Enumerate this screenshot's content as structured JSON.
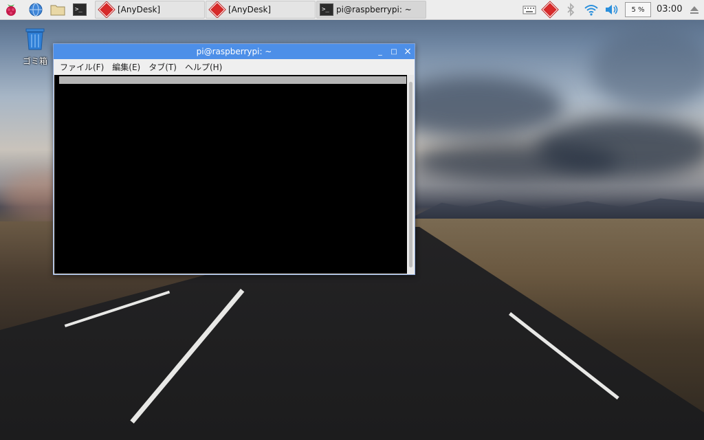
{
  "taskbar": {
    "tasks": [
      {
        "label": "[AnyDesk]"
      },
      {
        "label": "[AnyDesk]"
      },
      {
        "label": "pi@raspberrypi: ~"
      }
    ],
    "cpu_usage": "5 %",
    "clock": "03:00"
  },
  "desktop": {
    "trash_label": "ゴミ箱"
  },
  "terminal": {
    "title": "pi@raspberrypi: ~",
    "menu": [
      "ファイル(F)",
      "編集(E)",
      "タブ(T)",
      "ヘルプ(H)"
    ],
    "controls": {
      "minimize": "_",
      "maximize": "□",
      "close": "×"
    }
  },
  "colors": {
    "titlebar": "#4d8fe8",
    "anydesk_red": "#d62a2a",
    "terminal_bg": "#000000"
  }
}
